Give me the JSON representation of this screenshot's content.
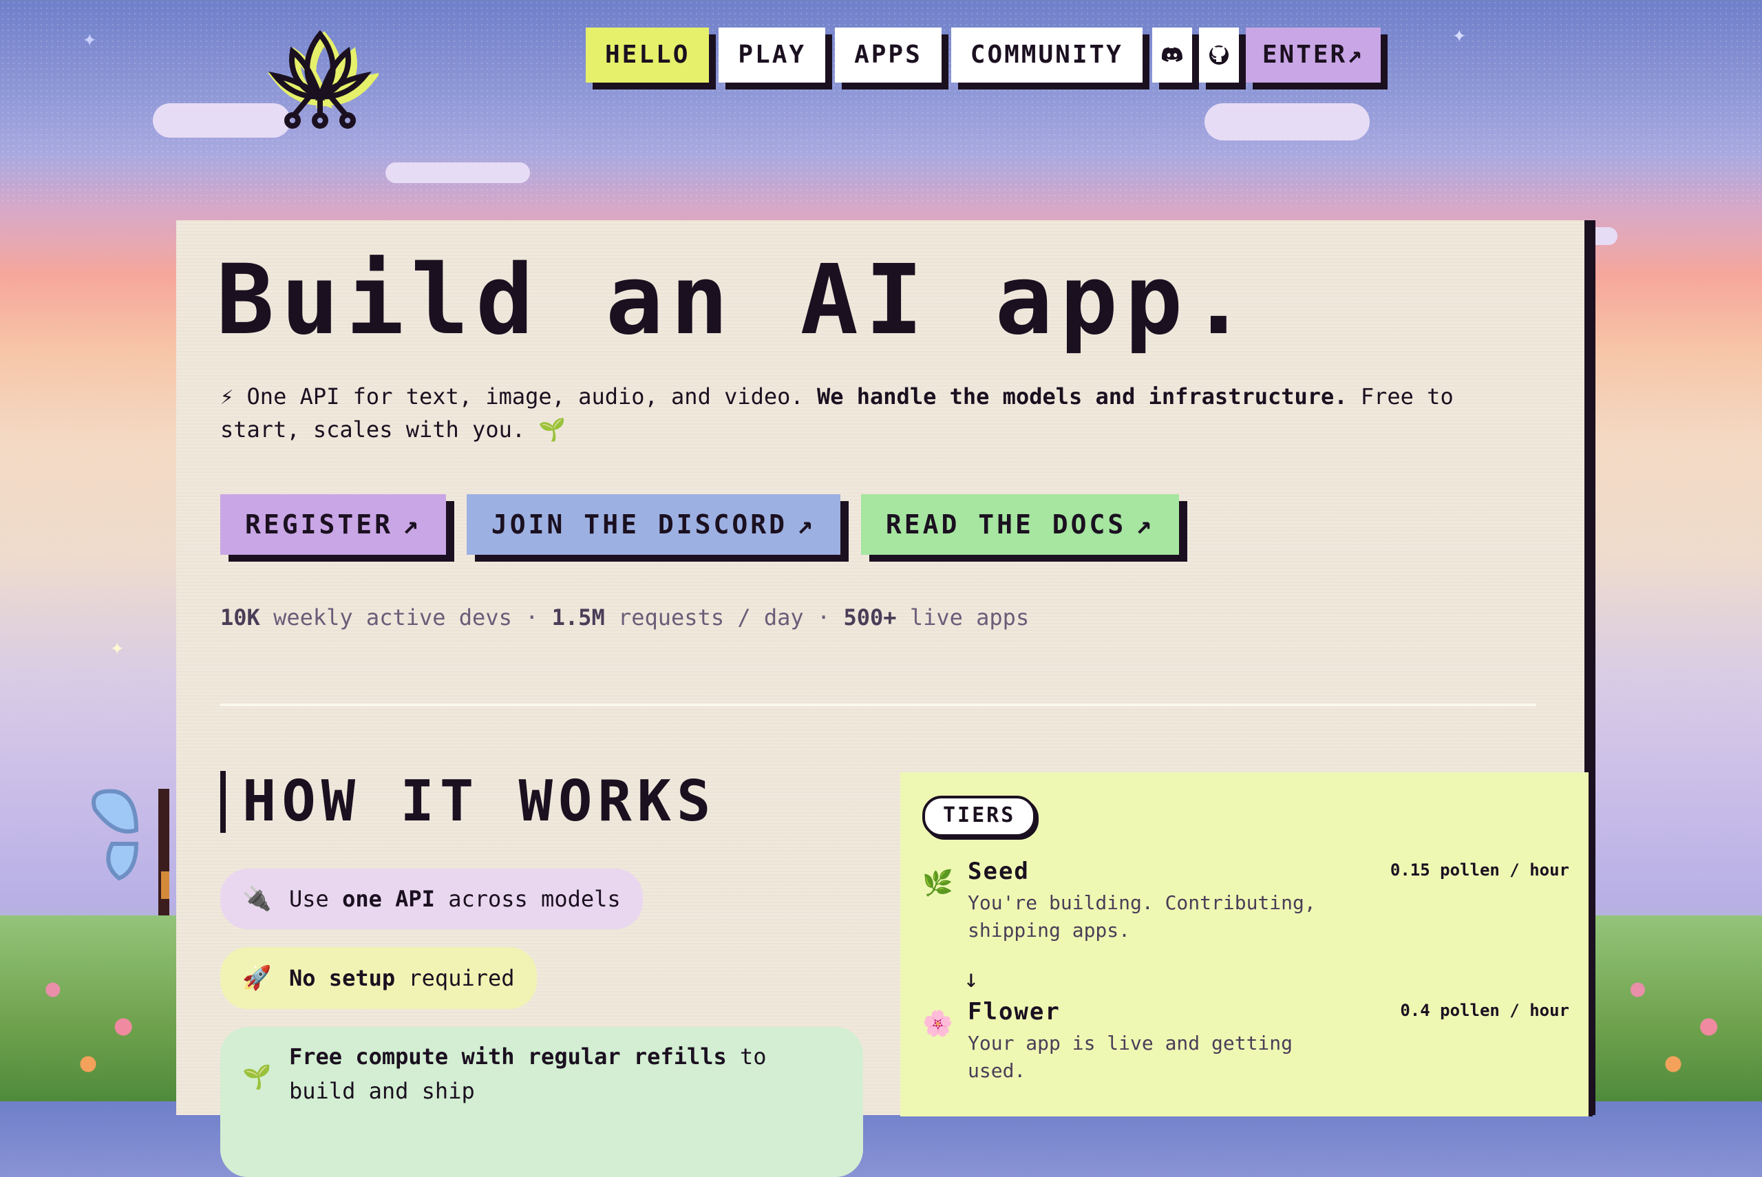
{
  "nav": {
    "items": [
      {
        "label": "HELLO",
        "active": true
      },
      {
        "label": "PLAY",
        "active": false
      },
      {
        "label": "APPS",
        "active": false
      },
      {
        "label": "COMMUNITY",
        "active": false
      }
    ],
    "discord_icon": "discord-icon",
    "github_icon": "github-icon",
    "enter_label": "ENTER",
    "enter_arrow": "↗"
  },
  "hero": {
    "title": "Build an AI app.",
    "desc_emoji_start": "⚡",
    "desc_part1": " One API for text, image, audio, and video. ",
    "desc_bold": "We handle the models and infrastructure.",
    "desc_part2": " Free to start, scales with you. ",
    "desc_emoji_end": "🌱",
    "cta": [
      {
        "label": "REGISTER",
        "arrow": "↗"
      },
      {
        "label": "JOIN THE DISCORD",
        "arrow": "↗"
      },
      {
        "label": "READ THE DOCS",
        "arrow": "↗"
      }
    ]
  },
  "stats": {
    "devs_num": "10K",
    "devs_label": " weekly active devs · ",
    "req_num": "1.5M",
    "req_label": " requests / day · ",
    "apps_num": "500+",
    "apps_label": " live apps"
  },
  "how": {
    "title": "HOW IT WORKS",
    "features": [
      {
        "emoji": "🔌",
        "pre": "Use ",
        "bold": "one API",
        "post": " across models"
      },
      {
        "emoji": "🚀",
        "pre": "",
        "bold": "No setup",
        "post": " required"
      },
      {
        "emoji": "🌱",
        "pre": "",
        "bold": "Free compute with regular refills",
        "post": " to build and ship"
      }
    ]
  },
  "tiers": {
    "badge": "TIERS",
    "arrow": "↓",
    "items": [
      {
        "emoji": "🌿",
        "name": "Seed",
        "rate": "0.15 pollen / hour",
        "desc": "You're building. Contributing, shipping apps."
      },
      {
        "emoji": "🌸",
        "name": "Flower",
        "rate": "0.4 pollen / hour",
        "desc": "Your app is live and getting used."
      }
    ]
  },
  "colors": {
    "ink": "#1b1020",
    "hello": "#e6f06a",
    "register": "#c9a6e5",
    "discord": "#9db0e2",
    "docs": "#a6e6a0",
    "card": "#f1e8dc",
    "tiers_bg": "#eef8b3"
  }
}
